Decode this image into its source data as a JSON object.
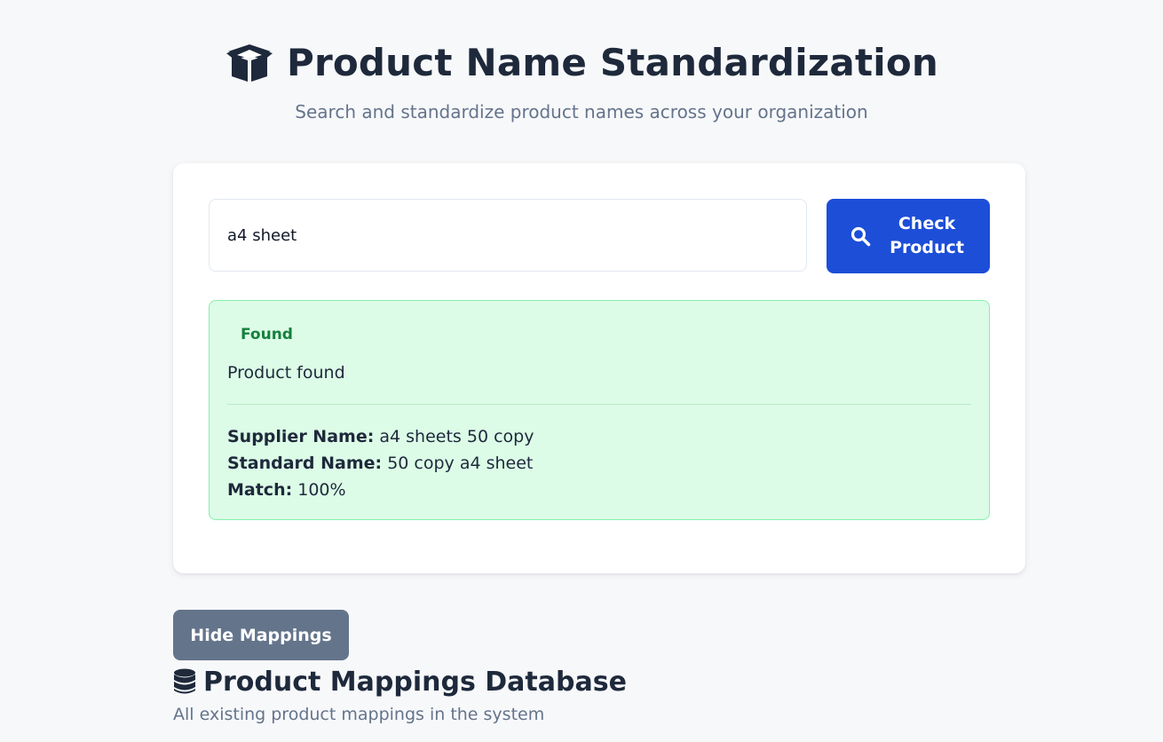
{
  "header": {
    "title": "Product Name Standardization",
    "subtitle": "Search and standardize product names across your organization",
    "icon": "box-open-icon"
  },
  "search": {
    "value": "a4 sheet",
    "placeholder": "",
    "button_label": "Check Product",
    "button_icon": "search-icon"
  },
  "result": {
    "status": "Found",
    "message": "Product found",
    "details": [
      {
        "label": "Supplier Name:",
        "value": "a4 sheets 50 copy"
      },
      {
        "label": "Standard Name:",
        "value": "50 copy a4 sheet"
      },
      {
        "label": "Match:",
        "value": "100%"
      }
    ]
  },
  "mappings": {
    "toggle_label": "Hide Mappings",
    "title": "Product Mappings Database",
    "subtitle": "All existing product mappings in the system",
    "icon": "database-icon"
  },
  "colors": {
    "primary": "#1d4ed8",
    "success_bg": "#dcfce7",
    "success_border": "#86efac",
    "success_text": "#15803d",
    "secondary_button": "#64748b"
  }
}
